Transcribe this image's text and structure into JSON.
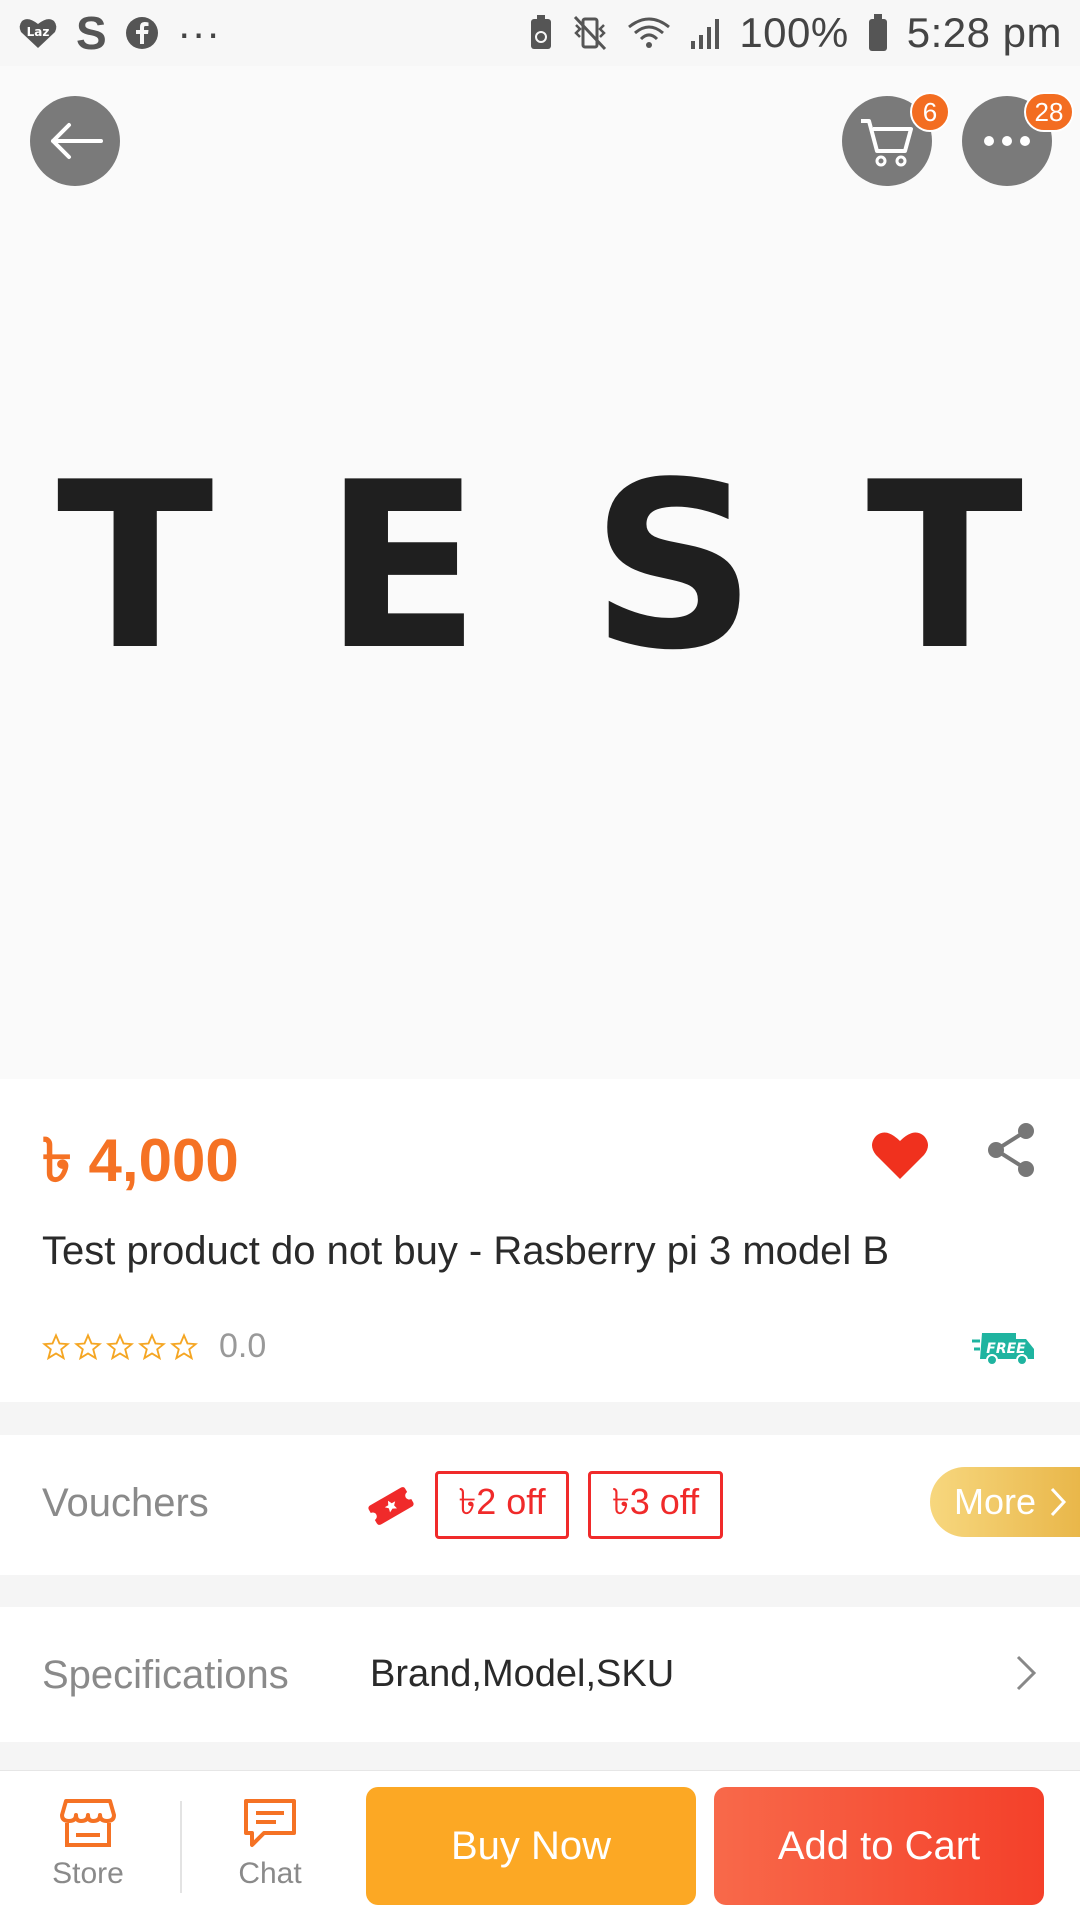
{
  "status_bar": {
    "battery": "100%",
    "time": "5:28 pm",
    "app_icon_s": "S",
    "dots": "···",
    "laz_logo": "Laz"
  },
  "hero": {
    "image_text": "TEST"
  },
  "header": {
    "cart_count": "6",
    "more_count": "28"
  },
  "product": {
    "price": "৳ 4,000",
    "title": "Test product do not buy - Rasberry pi 3 model B",
    "rating": "0.0",
    "free_label": "FREE"
  },
  "vouchers": {
    "label": "Vouchers",
    "items": [
      "৳2 off",
      "৳3 off"
    ],
    "more_label": "More"
  },
  "specifications": {
    "label": "Specifications",
    "value": "Brand,Model,SKU"
  },
  "bottom_bar": {
    "store_label": "Store",
    "chat_label": "Chat",
    "buy_now_label": "Buy Now",
    "add_to_cart_label": "Add to Cart"
  },
  "colors": {
    "accent_orange": "#f57224",
    "buy_now": "#fca824",
    "add_to_cart": "#f5502f",
    "voucher_red": "#f02a2a"
  }
}
